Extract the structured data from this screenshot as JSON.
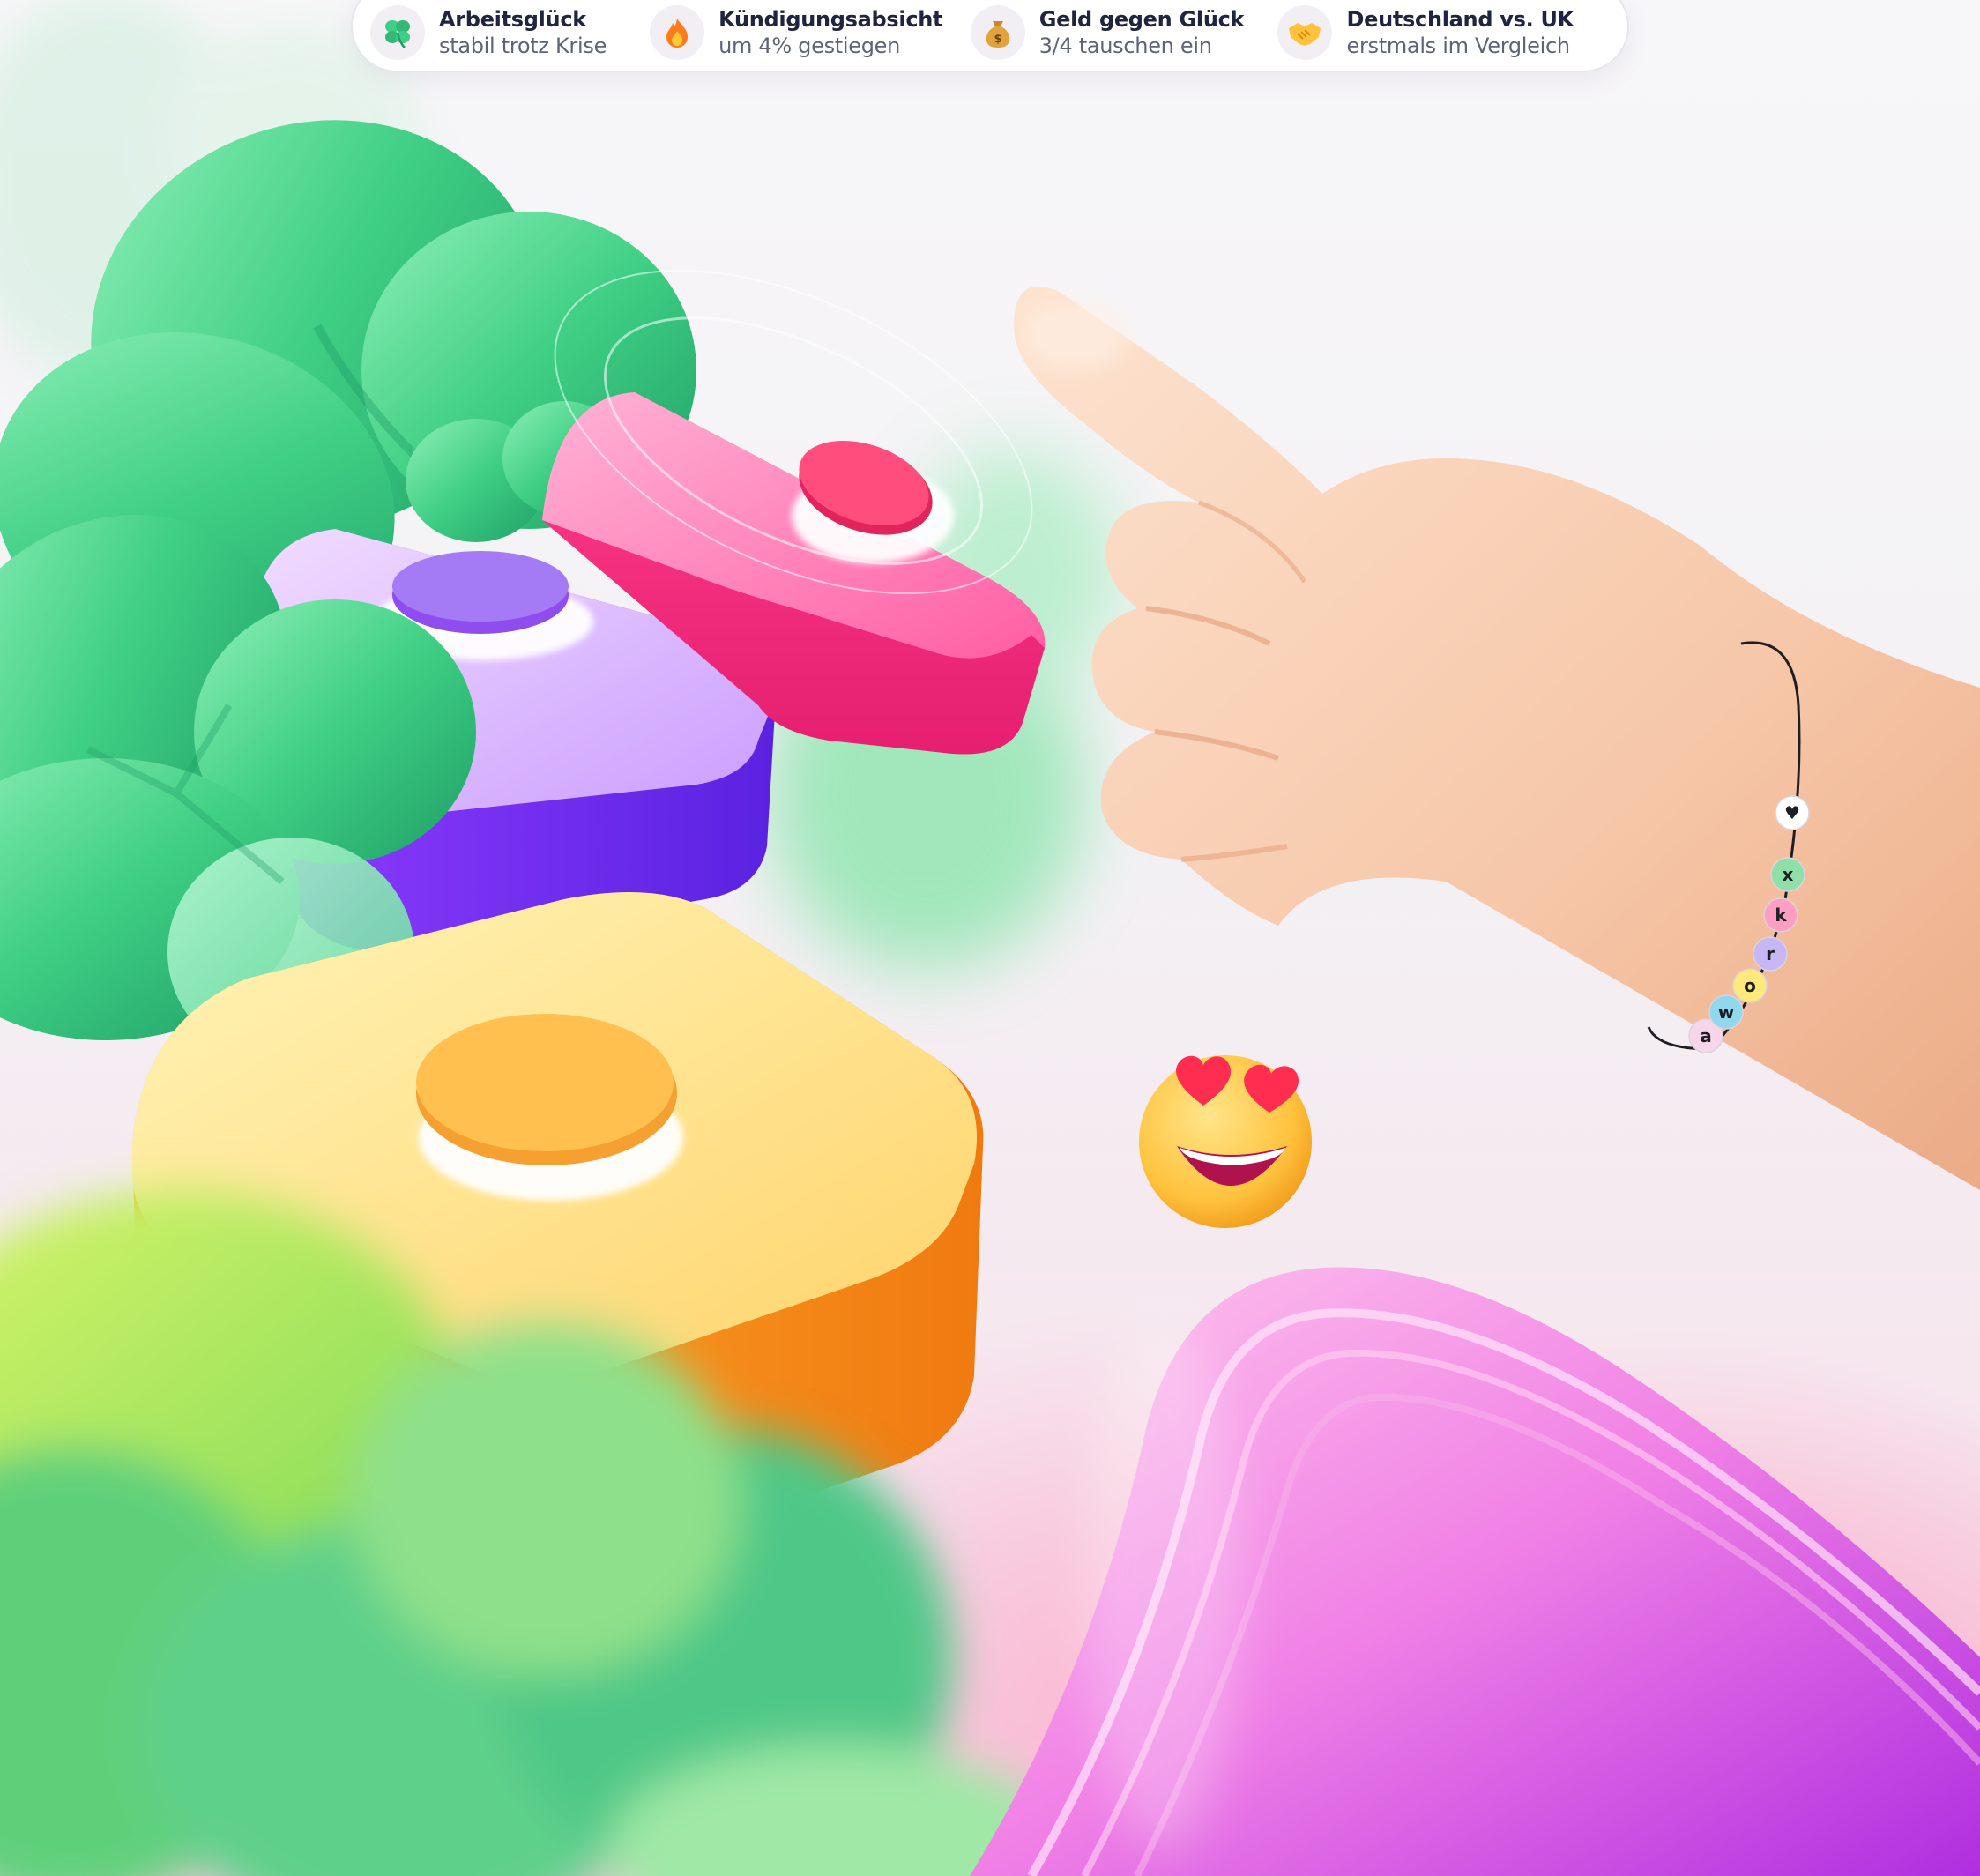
{
  "stats": [
    {
      "title": "Arbeitsglück",
      "subtitle": "stabil trotz Krise",
      "icon": "four-leaf-clover-icon"
    },
    {
      "title": "Kündigungsabsicht",
      "subtitle": "um 4% gestiegen",
      "icon": "flame-icon"
    },
    {
      "title": "Geld gegen Glück",
      "subtitle": "3/4 tauschen ein",
      "icon": "money-bag-icon"
    },
    {
      "title": "Deutschland vs. UK",
      "subtitle": "erstmals im Vergleich",
      "icon": "handshake-icon"
    }
  ],
  "illustration": {
    "bracelet_beads": [
      "a",
      "w",
      "o",
      "r",
      "k",
      "x",
      "♥"
    ],
    "colors": {
      "clover": "#3fcf84",
      "pink_button": "#ff3d8b",
      "purple_button": "#7a2cf0",
      "yellow_button": "#ffb230",
      "ribbon": "#e45cf0",
      "skin": "#f6c7a8"
    }
  }
}
